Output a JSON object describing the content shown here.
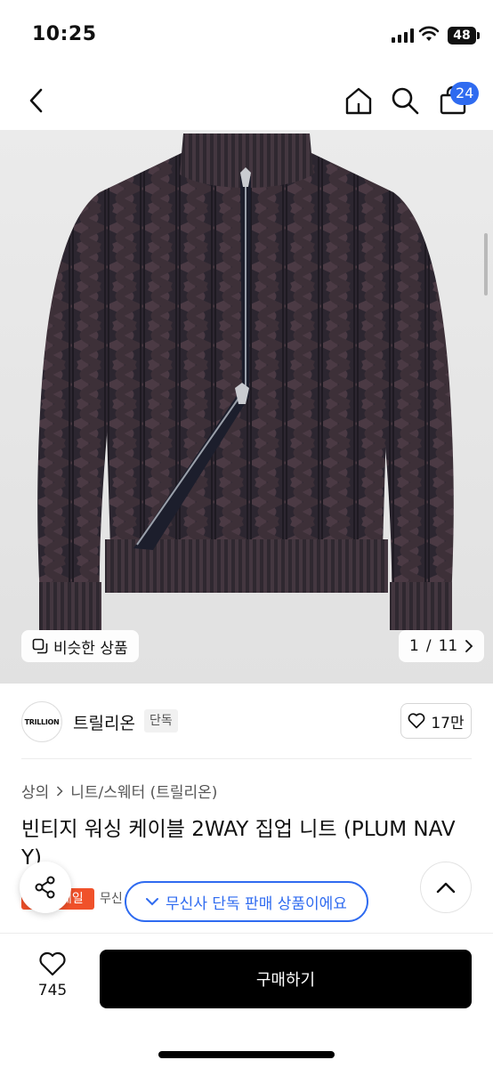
{
  "status_bar": {
    "time": "10:25",
    "battery": "48"
  },
  "nav": {
    "back_icon": "chevron-left-icon",
    "home_icon": "home-icon",
    "search_icon": "search-icon",
    "cart_icon": "shopping-bag-icon",
    "cart_count": "24"
  },
  "gallery": {
    "similar_label": "비슷한 상품",
    "page_current": "1",
    "page_total": "11",
    "pager_separator": "/"
  },
  "brand": {
    "logo_text": "TRILLION",
    "name": "트릴리온",
    "tag": "단독",
    "likes": "17만"
  },
  "product": {
    "breadcrumb": [
      "상의",
      "니트/스웨터 (트릴리온)"
    ],
    "title": "빈티지 워싱 케이블 2WAY 집업 니트 (PLUM NAVY)",
    "chip_sale": "세일",
    "chip_musinsa": "무신"
  },
  "toast": {
    "text": "무신사 단독 판매 상품이에요"
  },
  "bottom_bar": {
    "fav_count": "745",
    "buy_label": "구매하기"
  },
  "colors": {
    "accent": "#2f6bf0",
    "sale": "#f0512a",
    "buy": "#000000"
  }
}
